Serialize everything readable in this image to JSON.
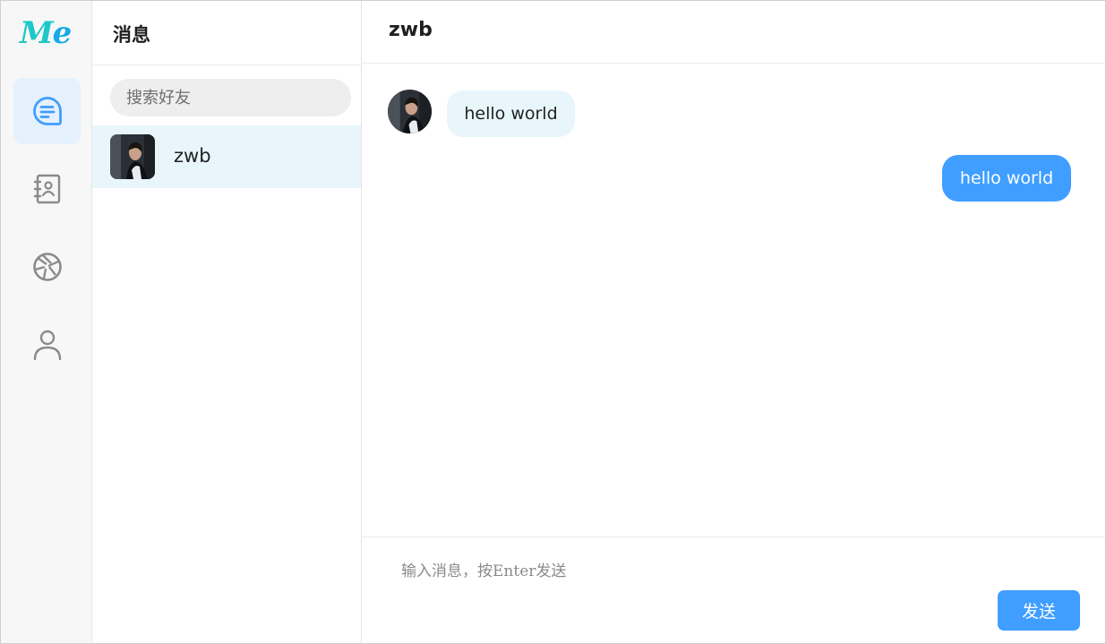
{
  "app": {
    "logo_text_m": "M",
    "logo_text_e": "e"
  },
  "nav": {
    "items": [
      {
        "name": "messages",
        "icon": "chat-icon",
        "active": true
      },
      {
        "name": "contacts",
        "icon": "contact-book-icon",
        "active": false
      },
      {
        "name": "moments",
        "icon": "aperture-icon",
        "active": false
      },
      {
        "name": "profile",
        "icon": "user-icon",
        "active": false
      }
    ]
  },
  "contacts": {
    "title": "消息",
    "search_placeholder": "搜索好友",
    "list": [
      {
        "name": "zwb",
        "selected": true
      }
    ]
  },
  "chat": {
    "title": "zwb",
    "messages": [
      {
        "direction": "incoming",
        "text": "hello world"
      },
      {
        "direction": "outgoing",
        "text": "hello world"
      }
    ],
    "input_placeholder": "输入消息，按Enter发送",
    "send_label": "发送"
  },
  "colors": {
    "accent": "#3f9eff",
    "selected_bg": "#e8f6fc",
    "nav_active_bg": "#e6f1fe",
    "logo_teal": "#1ec7c8",
    "logo_blue": "#18a9e8"
  }
}
